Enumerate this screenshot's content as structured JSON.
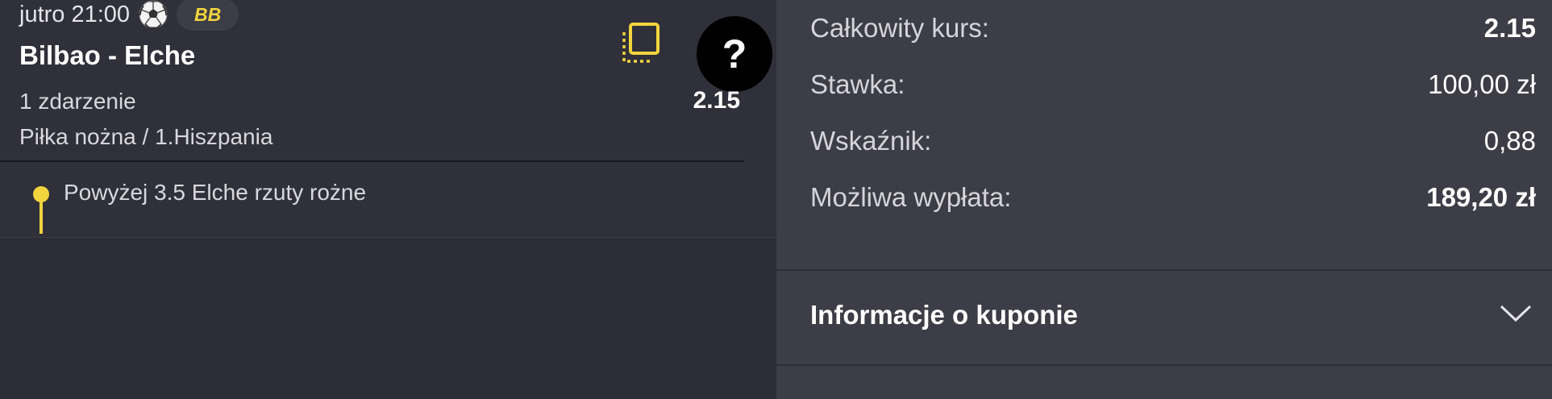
{
  "bet": {
    "time": "jutro 21:00",
    "sport_icon": "soccer-ball-icon",
    "badge": "BB",
    "match": "Bilbao - Elche",
    "copy_icon": "copy-icon",
    "help_label": "?",
    "events_count": "1 zdarzenie",
    "odds": "2.15",
    "league": "Piłka nożna / 1.Hiszpania",
    "selection": "Powyżej 3.5 Elche rzuty rożne"
  },
  "summary": {
    "total_odds_label": "Całkowity kurs:",
    "total_odds_value": "2.15",
    "stake_label": "Stawka:",
    "stake_value": "100,00 zł",
    "ratio_label": "Wskaźnik:",
    "ratio_value": "0,88",
    "payout_label": "Możliwa wypłata:",
    "payout_value": "189,20 zł"
  },
  "info": {
    "title": "Informacje o kuponie",
    "chevron_icon": "chevron-down-icon"
  },
  "colors": {
    "accent_yellow": "#f2d43d",
    "left_bg": "#30303a",
    "right_bg": "#3d3d47"
  }
}
